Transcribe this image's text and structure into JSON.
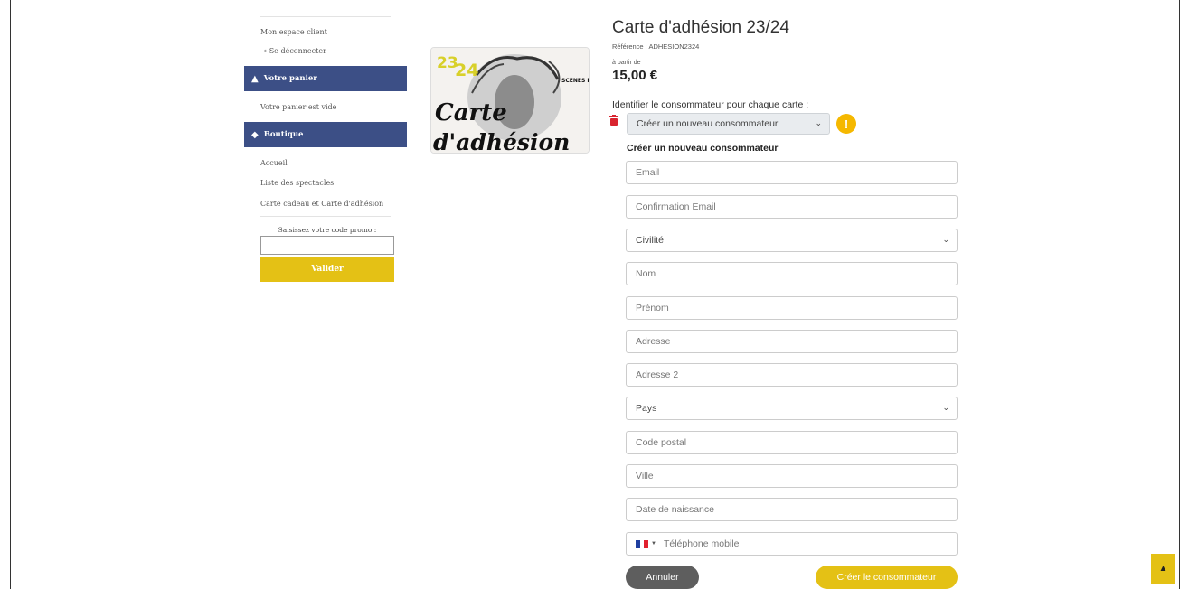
{
  "sidebar": {
    "links_top": [
      {
        "label": "Mon espace client",
        "icon": ""
      },
      {
        "label": "Se déconnecter",
        "icon": "logout-icon"
      }
    ],
    "cart_header": "Votre panier",
    "cart_empty": "Votre panier est vide",
    "shop_header": "Boutique",
    "shop_links": [
      "Accueil",
      "Liste des spectacles",
      "Carte cadeau et Carte d'adhésion"
    ],
    "promo_label": "Saisissez votre code promo :",
    "promo_value": "",
    "promo_button": "Valider"
  },
  "product": {
    "image_text_year_a": "23",
    "image_text_year_b": "24",
    "image_text_line1": "Carte",
    "image_text_line2": "d'adhésion",
    "image_text_brand": "SCÈNES DU GOLFE",
    "title": "Carte d'adhésion 23/24",
    "reference": "Référence : ADHESION2324",
    "from_label": "à partir de",
    "price": "15,00 €"
  },
  "consumer": {
    "identify_label": "Identifier le consommateur pour chaque carte :",
    "select_value": "Créer un nouveau consommateur",
    "warning_icon": "!",
    "form_title": "Créer un nouveau consommateur"
  },
  "form": {
    "email": "Email",
    "email_confirm": "Confirmation Email",
    "civility": "Civilité",
    "lastname": "Nom",
    "firstname": "Prénom",
    "address": "Adresse",
    "address2": "Adresse 2",
    "country": "Pays",
    "postal_code": "Code postal",
    "city": "Ville",
    "birthdate": "Date de naissance",
    "phone": "Téléphone mobile",
    "cancel": "Annuler",
    "create": "Créer le consommateur"
  },
  "colors": {
    "sidebar_header": "#3c4f86",
    "accent_yellow": "#e4c115",
    "trash_red": "#d9242f",
    "warning": "#f5b800"
  }
}
